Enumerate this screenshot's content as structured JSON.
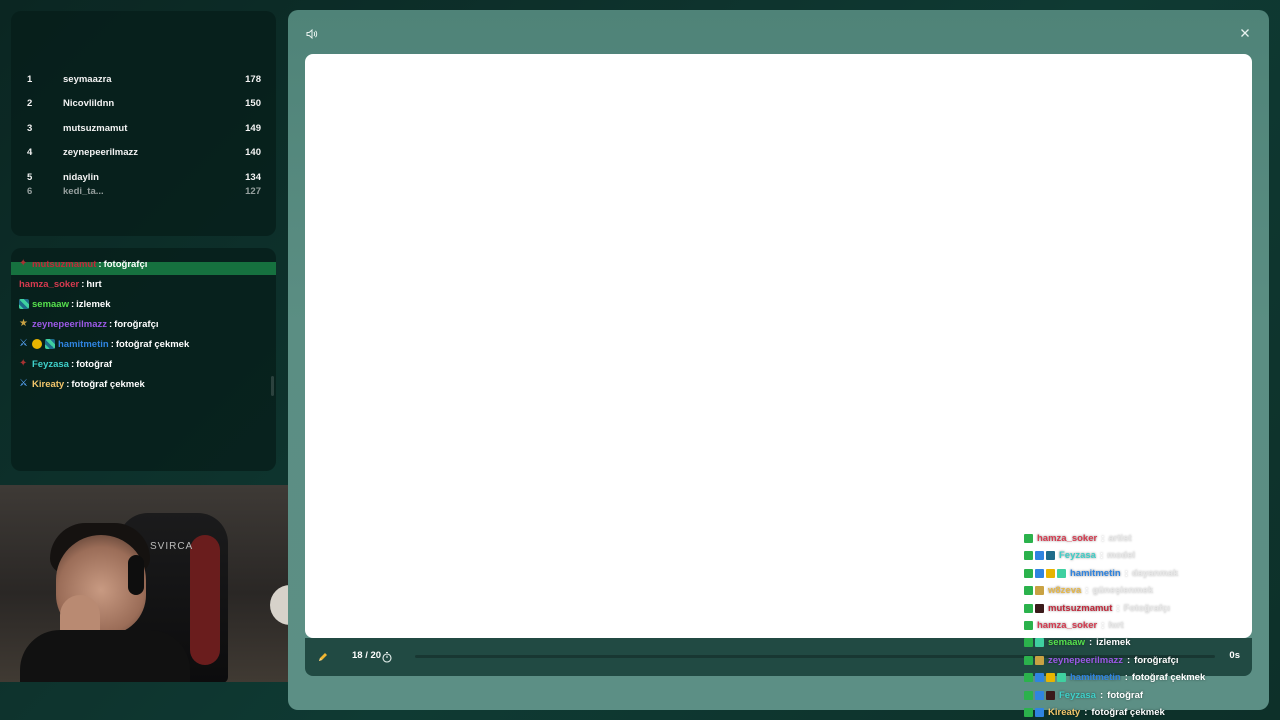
{
  "leaderboard": {
    "rows": [
      {
        "rank": "1",
        "name": "seymaazra",
        "score": "178"
      },
      {
        "rank": "2",
        "name": "Nicovlildnn",
        "score": "150"
      },
      {
        "rank": "3",
        "name": "mutsuzmamut",
        "score": "149"
      },
      {
        "rank": "4",
        "name": "zeynepeerilmazz",
        "score": "140"
      },
      {
        "rank": "5",
        "name": "nidaylin",
        "score": "134"
      },
      {
        "rank": "6",
        "name": "kedi_ta...",
        "score": "127"
      }
    ]
  },
  "side_chat": {
    "lines": [
      {
        "user": "mutsuzmamut",
        "sep": ":",
        "msg": "fotoğrafçı",
        "color": "#c0283a"
      },
      {
        "user": "hamza_soker",
        "sep": ":",
        "msg": "hırt",
        "color": "#d63a4f"
      },
      {
        "user": "semaaw",
        "sep": ":",
        "msg": "izlemek",
        "color": "#56e04d"
      },
      {
        "user": "zeynepeerilmazz",
        "sep": ":",
        "msg": "foroğrafçı",
        "color": "#9b59e6"
      },
      {
        "user": "hamitmetin",
        "sep": ":",
        "msg": "fotoğraf çekmek",
        "color": "#2f84e0"
      },
      {
        "user": "Feyzasa",
        "sep": ":",
        "msg": "fotoğraf",
        "color": "#3fd0c9"
      },
      {
        "user": "Kireaty",
        "sep": ":",
        "msg": "fotoğraf çekmek",
        "color": "#f2c66b"
      }
    ]
  },
  "webcam": {
    "chair_text": "SVIRCA"
  },
  "main": {
    "progress": "18 / 20",
    "progress_fraction": 0.0,
    "timer": "0s",
    "icons": {
      "sound": "speaker-icon",
      "close": "close-icon",
      "pencil": "pencil-icon",
      "stopwatch": "stopwatch-icon"
    }
  },
  "overlay_chat": {
    "lines": [
      {
        "user": "hamza_soker",
        "sep": ":",
        "msg": "artist",
        "color": "#d63a4f",
        "faded": true
      },
      {
        "user": "Feyzasa",
        "sep": ":",
        "msg": "model",
        "color": "#3fd0c9",
        "faded": true
      },
      {
        "user": "hamitmetin",
        "sep": ":",
        "msg": "dayanmak",
        "color": "#2f84e0",
        "faded": true
      },
      {
        "user": "w8zeva",
        "sep": ":",
        "msg": "güneşlenmek",
        "color": "#e6b84a",
        "faded": true
      },
      {
        "user": "mutsuzmamut",
        "sep": ":",
        "msg": "Fotoğrafçı",
        "color": "#c0283a",
        "faded": true
      },
      {
        "user": "hamza_soker",
        "sep": ":",
        "msg": "hırt",
        "color": "#d63a4f",
        "faded": true
      },
      {
        "user": "semaaw",
        "sep": ":",
        "msg": "izlemek",
        "color": "#56e04d",
        "faded": false
      },
      {
        "user": "zeynepeerilmazz",
        "sep": ":",
        "msg": "foroğrafçı",
        "color": "#9b59e6",
        "faded": false
      },
      {
        "user": "hamitmetin",
        "sep": ":",
        "msg": "fotoğraf çekmek",
        "color": "#2f84e0",
        "faded": false
      },
      {
        "user": "Feyzasa",
        "sep": ":",
        "msg": "fotoğraf",
        "color": "#3fd0c9",
        "faded": false
      },
      {
        "user": "Kireaty",
        "sep": ":",
        "msg": "fotoğraf çekmek",
        "color": "#f2c66b",
        "faded": false
      }
    ]
  }
}
